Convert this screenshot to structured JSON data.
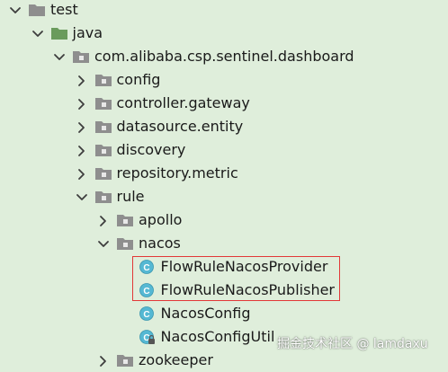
{
  "colors": {
    "background": "#dfeedb",
    "folder_gray": "#8e8e8e",
    "folder_green": "#6a9b5c",
    "class_icon": "#55b8d3",
    "highlight_border": "#e23838"
  },
  "tree": [
    {
      "label": "test",
      "depth": 0,
      "expander": "chevron-down",
      "icon": "folder-gray"
    },
    {
      "label": "java",
      "depth": 1,
      "expander": "chevron-down",
      "icon": "folder-green"
    },
    {
      "label": "com.alibaba.csp.sentinel.dashboard",
      "depth": 2,
      "expander": "chevron-down",
      "icon": "package"
    },
    {
      "label": "config",
      "depth": 3,
      "expander": "chevron-right",
      "icon": "package"
    },
    {
      "label": "controller.gateway",
      "depth": 3,
      "expander": "chevron-right",
      "icon": "package"
    },
    {
      "label": "datasource.entity",
      "depth": 3,
      "expander": "chevron-right",
      "icon": "package"
    },
    {
      "label": "discovery",
      "depth": 3,
      "expander": "chevron-right",
      "icon": "package"
    },
    {
      "label": "repository.metric",
      "depth": 3,
      "expander": "chevron-right",
      "icon": "package"
    },
    {
      "label": "rule",
      "depth": 3,
      "expander": "chevron-down",
      "icon": "package"
    },
    {
      "label": "apollo",
      "depth": 4,
      "expander": "chevron-right",
      "icon": "package"
    },
    {
      "label": "nacos",
      "depth": 4,
      "expander": "chevron-down",
      "icon": "package"
    },
    {
      "label": "FlowRuleNacosProvider",
      "depth": 5,
      "expander": "none",
      "icon": "class",
      "highlighted": true
    },
    {
      "label": "FlowRuleNacosPublisher",
      "depth": 5,
      "expander": "none",
      "icon": "class",
      "highlighted": true
    },
    {
      "label": "NacosConfig",
      "depth": 5,
      "expander": "none",
      "icon": "class"
    },
    {
      "label": "NacosConfigUtil",
      "depth": 5,
      "expander": "none",
      "icon": "class-lock"
    },
    {
      "label": "zookeeper",
      "depth": 4,
      "expander": "chevron-right",
      "icon": "package"
    }
  ],
  "watermark": "掘金技术社区 @ lamdaxu"
}
